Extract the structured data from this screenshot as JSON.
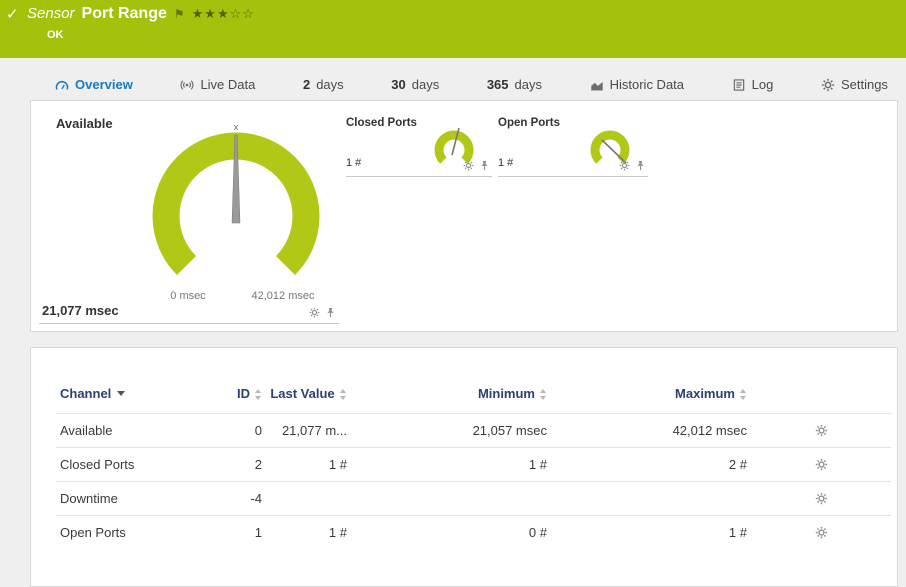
{
  "colors": {
    "header_green": "#a4c20c",
    "gauge_green": "#b2c817",
    "active_tab_blue": "#1a79c0",
    "table_header_blue": "#2c4170"
  },
  "header": {
    "check_icon": "✓",
    "type_label": "Sensor",
    "title": "Port Range",
    "flag_icon": "⚑",
    "stars": "★★★☆☆",
    "priority_filled": 3,
    "priority_total": 5,
    "status": "OK"
  },
  "tabs": [
    {
      "label": "Overview"
    },
    {
      "label": "Live Data"
    },
    {
      "bold": "2",
      "label": "days"
    },
    {
      "bold": "30",
      "label": "days"
    },
    {
      "bold": "365",
      "label": "days"
    },
    {
      "label": "Historic Data"
    },
    {
      "label": "Log"
    },
    {
      "label": "Settings"
    }
  ],
  "gauges": {
    "main": {
      "title": "Available",
      "value": "21,077 msec",
      "min_label": "0 msec",
      "max_label": "42,012 msec",
      "marker": "x"
    },
    "closed_ports": {
      "title": "Closed Ports",
      "value": "1 #"
    },
    "open_ports": {
      "title": "Open Ports",
      "value": "1 #"
    }
  },
  "table": {
    "headers": {
      "channel": "Channel",
      "id": "ID",
      "last_value": "Last Value",
      "minimum": "Minimum",
      "maximum": "Maximum"
    },
    "rows": [
      {
        "channel": "Available",
        "id": "0",
        "last_value": "21,077 m...",
        "minimum": "21,057 msec",
        "maximum": "42,012 msec"
      },
      {
        "channel": "Closed Ports",
        "id": "2",
        "last_value": "1 #",
        "minimum": "1 #",
        "maximum": "2 #"
      },
      {
        "channel": "Downtime",
        "id": "-4",
        "last_value": "",
        "minimum": "",
        "maximum": ""
      },
      {
        "channel": "Open Ports",
        "id": "1",
        "last_value": "1 #",
        "minimum": "0 #",
        "maximum": "1 #"
      }
    ]
  }
}
